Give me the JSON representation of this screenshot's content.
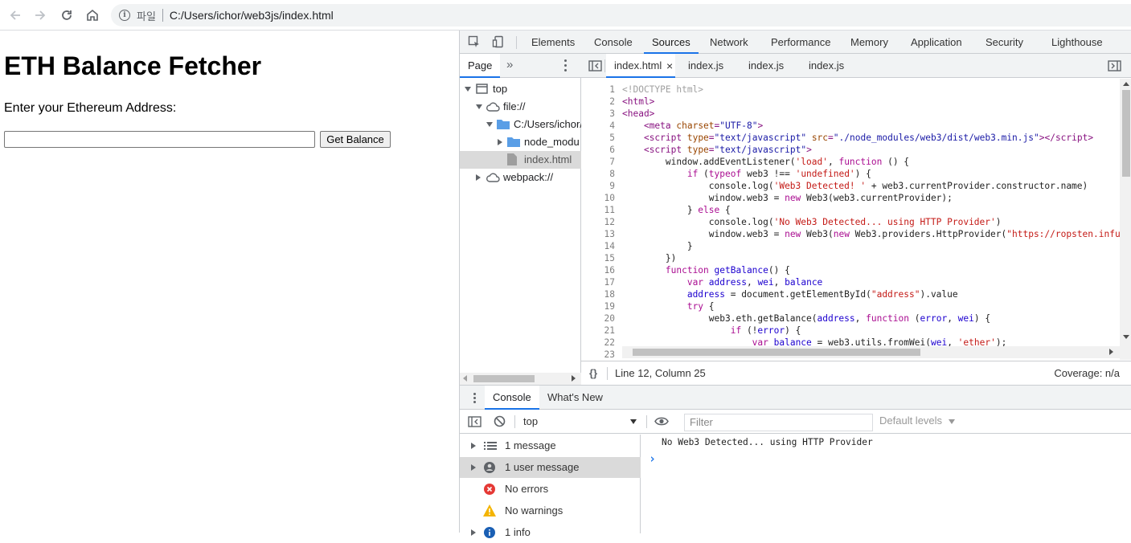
{
  "browser": {
    "scheme_label": "파일",
    "url": "C:/Users/ichor/web3js/index.html"
  },
  "page": {
    "heading": "ETH Balance Fetcher",
    "prompt": "Enter your Ethereum Address:",
    "address_value": "",
    "button_label": "Get Balance"
  },
  "devtools": {
    "tabs": [
      "Elements",
      "Console",
      "Sources",
      "Network",
      "Performance",
      "Memory",
      "Application",
      "Security",
      "Lighthouse"
    ],
    "active_tab": "Sources",
    "navigator": {
      "tab": "Page",
      "more": "»",
      "tree": [
        {
          "label": "top",
          "icon": "frame-icon"
        },
        {
          "label": "file://",
          "icon": "cloud-icon"
        },
        {
          "label": "C:/Users/ichor/",
          "icon": "folder-icon"
        },
        {
          "label": "node_modu",
          "icon": "folder-icon"
        },
        {
          "label": "index.html",
          "icon": "file-icon"
        },
        {
          "label": "webpack://",
          "icon": "cloud-icon"
        }
      ]
    },
    "editor": {
      "tabs": [
        "index.html",
        "index.js",
        "index.js",
        "index.js"
      ],
      "close": "×",
      "line_numbers": [
        "1",
        "2",
        "3",
        "4",
        "5",
        "6",
        "7",
        "8",
        "9",
        "10",
        "11",
        "12",
        "13",
        "14",
        "15",
        "16",
        "17",
        "18",
        "19",
        "20",
        "21",
        "22",
        "23"
      ],
      "status": "Line 12, Column 25",
      "coverage": "Coverage: n/a",
      "format_icon": "{}"
    },
    "drawer": {
      "tabs": [
        "Console",
        "What's New"
      ],
      "context": "top",
      "filter_placeholder": "Filter",
      "levels": "Default levels",
      "sidebar": [
        {
          "label": "1 message",
          "icon": "list-icon"
        },
        {
          "label": "1 user message",
          "icon": "user-icon"
        },
        {
          "label": "No errors",
          "icon": "error-icon"
        },
        {
          "label": "No warnings",
          "icon": "warning-icon"
        },
        {
          "label": "1 info",
          "icon": "info-icon"
        }
      ],
      "output": "No Web3 Detected... using HTTP Provider",
      "prompt": "›"
    }
  }
}
